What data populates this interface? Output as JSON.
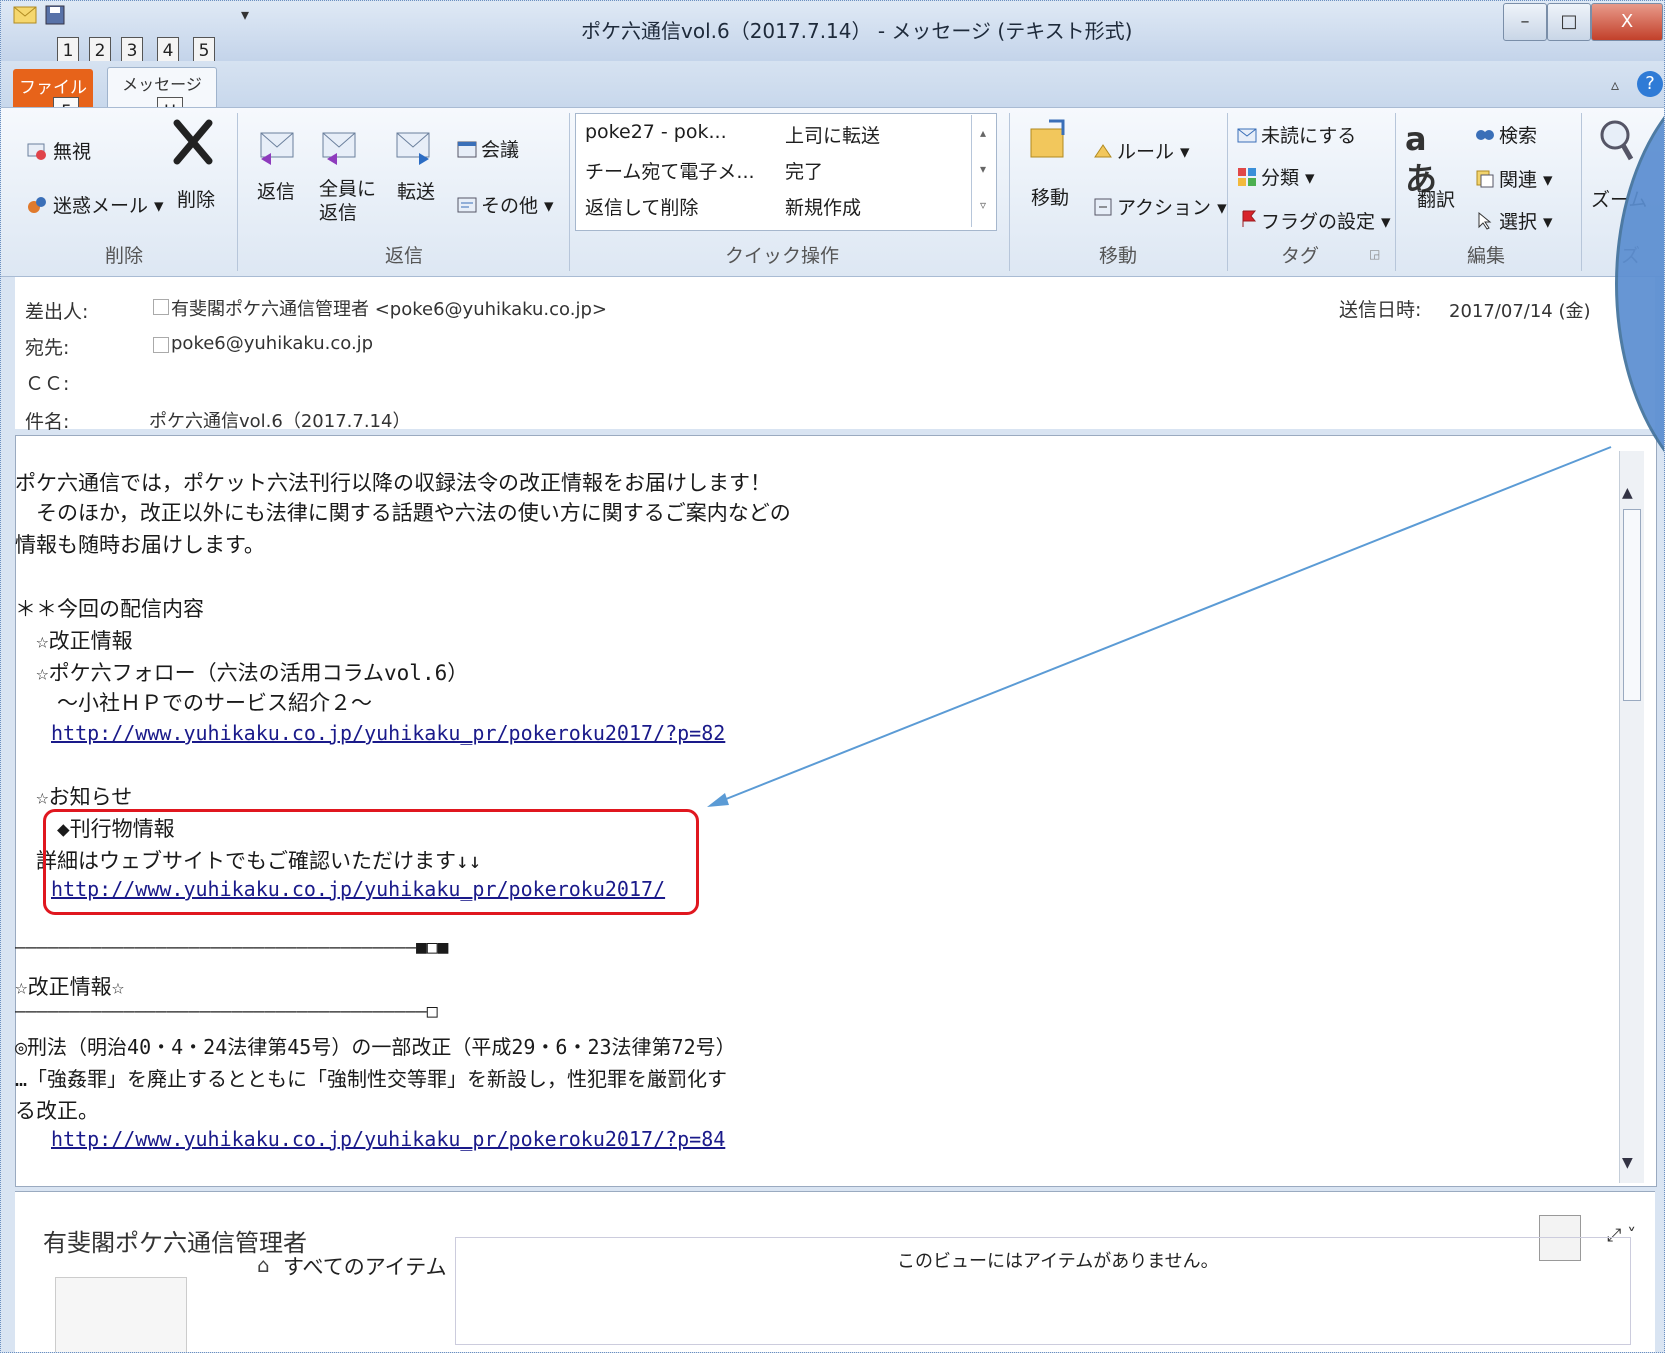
{
  "window": {
    "title": "ポケ六通信vol.6（2017.7.14） - メッセージ (テキスト形式)",
    "quick_access_keytips": [
      "1",
      "2",
      "3",
      "4",
      "5"
    ],
    "controls": {
      "minimize": "–",
      "maximize": "□",
      "close": "X"
    }
  },
  "tabs": [
    {
      "label": "ファイル",
      "keytip": "F"
    },
    {
      "label": "メッセージ",
      "keytip": "H"
    }
  ],
  "ribbon": {
    "delete_group": {
      "label": "削除",
      "ignore": "無視",
      "junk": "迷惑メール ▾",
      "delete": "削除"
    },
    "reply_group": {
      "label": "返信",
      "reply": "返信",
      "reply_all": "全員に返信",
      "forward": "転送",
      "meeting": "会議",
      "more": "その他 ▾"
    },
    "quick_steps": {
      "label": "クイック操作",
      "items": [
        "poke27 - pok...",
        "上司に転送",
        "チーム宛て電子メ...",
        "完了",
        "返信して削除",
        "新規作成"
      ]
    },
    "move_group": {
      "label": "移動",
      "move": "移動",
      "rules": "ルール ▾",
      "actions": "アクション ▾"
    },
    "tags_group": {
      "label": "タグ",
      "unread": "未読にする",
      "categorize": "分類 ▾",
      "followup": "フラグの設定 ▾"
    },
    "edit_group": {
      "label": "編集",
      "translate": "翻訳",
      "find": "検索",
      "related": "関連 ▾",
      "select": "選択 ▾"
    },
    "zoom_group": {
      "label": "ズ",
      "zoom": "ズーム"
    }
  },
  "header": {
    "from_label": "差出人:",
    "from_value": "有斐閣ポケ六通信管理者 <poke6@yuhikaku.co.jp>",
    "to_label": "宛先:",
    "to_value": "poke6@yuhikaku.co.jp",
    "cc_label": "ＣＣ:",
    "subject_label": "件名:",
    "subject_value": "ポケ六通信vol.6（2017.7.14）",
    "sent_label": "送信日時:",
    "sent_value": "2017/07/14 (金)"
  },
  "body": {
    "lines": [
      "ポケ六通信では，ポケット六法刊行以降の収録法令の改正情報をお届けします！",
      "　そのほか，改正以外にも法律に関する話題や六法の使い方に関するご案内などの",
      "情報も随時お届けします。",
      "",
      "＊＊今回の配信内容",
      "　☆改正情報",
      "　☆ポケ六フォロー（六法の活用コラムvol.6）",
      "　　～小社ＨＰでのサービス紹介２～"
    ],
    "link1": "http://www.yuhikaku.co.jp/yuhikaku_pr/pokeroku2017/?p=82",
    "notice": "　☆お知らせ",
    "pub_info": "　　◆刊行物情報",
    "detail": "　詳細はウェブサイトでもご確認いただけます↓↓",
    "link2": "http://www.yuhikaku.co.jp/yuhikaku_pr/pokeroku2017/",
    "divider1": "―――――――――――――――――――――――――――――――――――――■□■",
    "section_title": "☆改正情報☆",
    "divider2": "――――――――――――――――――――――――――――――――――――――□",
    "amend1": "◎刑法（明治40・4・24法律第45号）の一部改正（平成29・6・23法律第72号）",
    "amend2": "…「強姦罪」を廃止するとともに「強制性交等罪」を新設し，性犯罪を厳罰化す",
    "amend3": "る改正。",
    "link3": "http://www.yuhikaku.co.jp/yuhikaku_pr/pokeroku2017/?p=84"
  },
  "people_pane": {
    "name": "有斐閣ポケ六通信管理者",
    "all_items": "すべてのアイテム",
    "empty": "このビューにはアイテムがありません。"
  },
  "colors": {
    "accent_orange": "#e7631a",
    "callout_blue": "#5b8ed1",
    "highlight_red": "#e0171f",
    "arrow": "#5b9bd5"
  }
}
